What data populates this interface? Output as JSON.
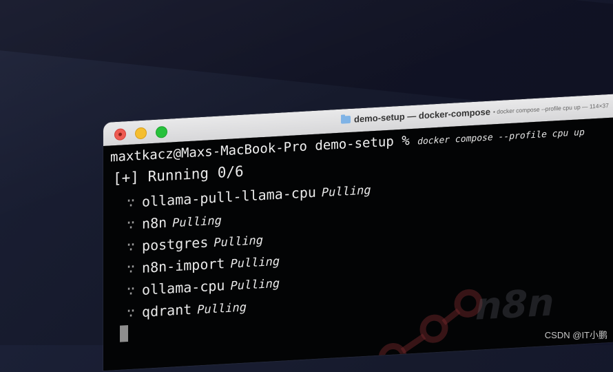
{
  "window": {
    "title_main": "demo-setup — docker-compose",
    "title_sub": "• docker compose --profile cpu up — 114×37"
  },
  "terminal": {
    "prompt": "maxtkacz@Maxs-MacBook-Pro demo-setup %",
    "command": "docker compose --profile cpu up",
    "status": "[+] Running 0/6",
    "services": [
      {
        "name": "ollama-pull-llama-cpu",
        "state": "Pulling"
      },
      {
        "name": "n8n",
        "state": "Pulling"
      },
      {
        "name": "postgres",
        "state": "Pulling"
      },
      {
        "name": "n8n-import",
        "state": "Pulling"
      },
      {
        "name": "ollama-cpu",
        "state": "Pulling"
      },
      {
        "name": "qdrant",
        "state": "Pulling"
      }
    ],
    "spinner_glyph": "∵"
  },
  "watermark": {
    "logo_text": "n8n"
  },
  "credit": "CSDN @IT小鹏"
}
